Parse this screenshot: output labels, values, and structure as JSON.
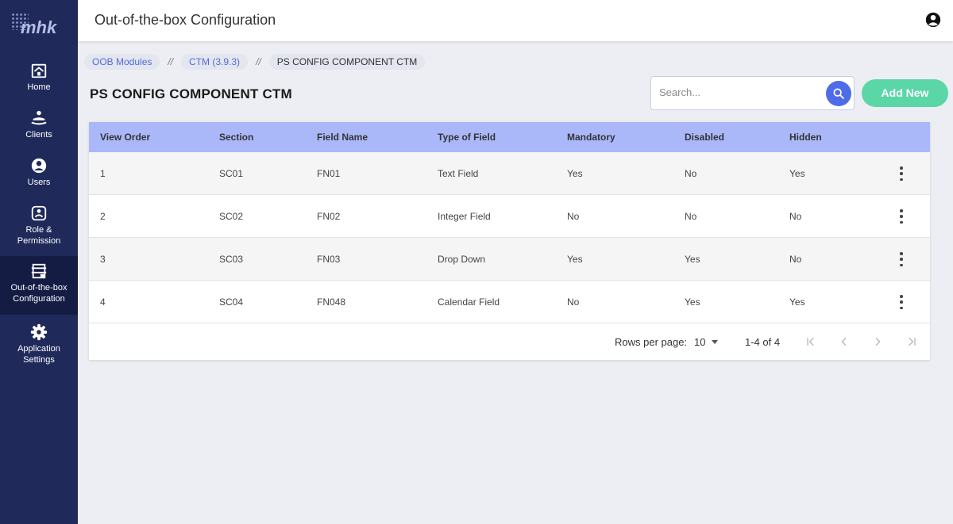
{
  "app": {
    "logo_text": "mhk"
  },
  "sidebar": {
    "items": [
      {
        "label": "Home",
        "icon": "home-icon",
        "active": false
      },
      {
        "label": "Clients",
        "icon": "clients-icon",
        "active": false
      },
      {
        "label": "Users",
        "icon": "user-icon",
        "active": false
      },
      {
        "label": "Role &\nPermission",
        "icon": "role-permission-icon",
        "active": false
      },
      {
        "label": "Out-of-the-box\nConfiguration",
        "icon": "configuration-icon",
        "active": true
      },
      {
        "label": "Application\nSettings",
        "icon": "gear-icon",
        "active": false
      }
    ]
  },
  "header": {
    "title": "Out-of-the-box Configuration",
    "account_icon": "account-circle-icon"
  },
  "breadcrumb": {
    "items": [
      "OOB Modules",
      "CTM (3.9.3)",
      "PS CONFIG COMPONENT CTM"
    ],
    "separator": "//"
  },
  "page": {
    "title": "PS CONFIG COMPONENT CTM"
  },
  "search": {
    "placeholder": "Search...",
    "value": ""
  },
  "actions": {
    "add_new_label": "Add New"
  },
  "table": {
    "headers": [
      "View Order",
      "Section",
      "Field Name",
      "Type of Field",
      "Mandatory",
      "Disabled",
      "Hidden"
    ],
    "rows": [
      [
        "1",
        "SC01",
        "FN01",
        "Text Field",
        "Yes",
        "No",
        "Yes"
      ],
      [
        "2",
        "SC02",
        "FN02",
        "Integer Field",
        "No",
        "No",
        "No"
      ],
      [
        "3",
        "SC03",
        "FN03",
        "Drop Down",
        "Yes",
        "Yes",
        "No"
      ],
      [
        "4",
        "SC04",
        "FN048",
        "Calendar Field",
        "No",
        "Yes",
        "Yes"
      ]
    ]
  },
  "pagination": {
    "rows_per_page_label": "Rows per page:",
    "rows_per_page_value": "10",
    "range_text": "1-4 of 4"
  },
  "colors": {
    "sidebar_bg": "#1f2a5a",
    "sidebar_active_bg": "#141c44",
    "table_header_bg": "#aab8fa",
    "accent_blue": "#4f6ce8",
    "add_button_green": "#5ad6a7"
  }
}
